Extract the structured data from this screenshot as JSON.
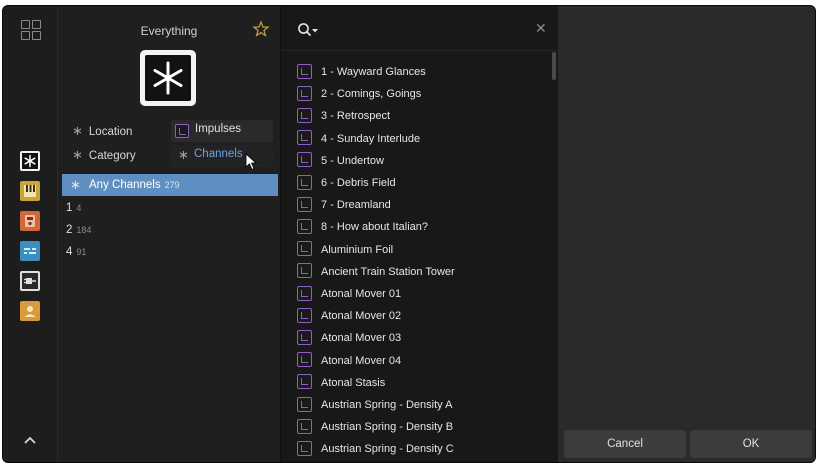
{
  "filter": {
    "title": "Everything",
    "location_label": "Location",
    "category_label": "Category",
    "impulses_label": "Impulses",
    "channels_label": "Channels",
    "any_channels": {
      "label": "Any Channels",
      "count": "279"
    },
    "options": [
      {
        "label": "1",
        "count": "4"
      },
      {
        "label": "2",
        "count": "184"
      },
      {
        "label": "4",
        "count": "91"
      }
    ]
  },
  "list": {
    "items": [
      "1 - Wayward Glances",
      "2 - Comings, Goings",
      "3 - Retrospect",
      "4 - Sunday Interlude",
      "5 - Undertow",
      "6 - Debris Field",
      "7 - Dreamland",
      "8 - How about Italian?",
      "Aluminium Foil",
      "Ancient Train Station Tower",
      "Atonal Mover 01",
      "Atonal Mover 02",
      "Atonal Mover 03",
      "Atonal Mover 04",
      "Atonal Stasis",
      "Austrian Spring - Density A",
      "Austrian Spring - Density B",
      "Austrian Spring - Density C"
    ]
  },
  "buttons": {
    "cancel": "Cancel",
    "ok": "OK"
  },
  "icons": {
    "rail": [
      "grid-icon",
      "asterisk-icon",
      "piano-icon",
      "device-icon",
      "modulator-icon",
      "plugin-icon",
      "user-icon",
      "chevron-up-icon"
    ],
    "search": "search-icon",
    "close": "close-icon",
    "star": "star-icon",
    "item": "impulse-file-icon"
  },
  "colors": {
    "accent": "#5f8fc0",
    "impulse_purple": "#8e5fc7",
    "channels_text": "#6fa2e0",
    "star_gold": "#c8a040",
    "piano_yellow": "#c9a43a",
    "device_orange": "#d0683a",
    "modulator_blue": "#3a8fc0",
    "user_orange": "#d89a3a"
  }
}
